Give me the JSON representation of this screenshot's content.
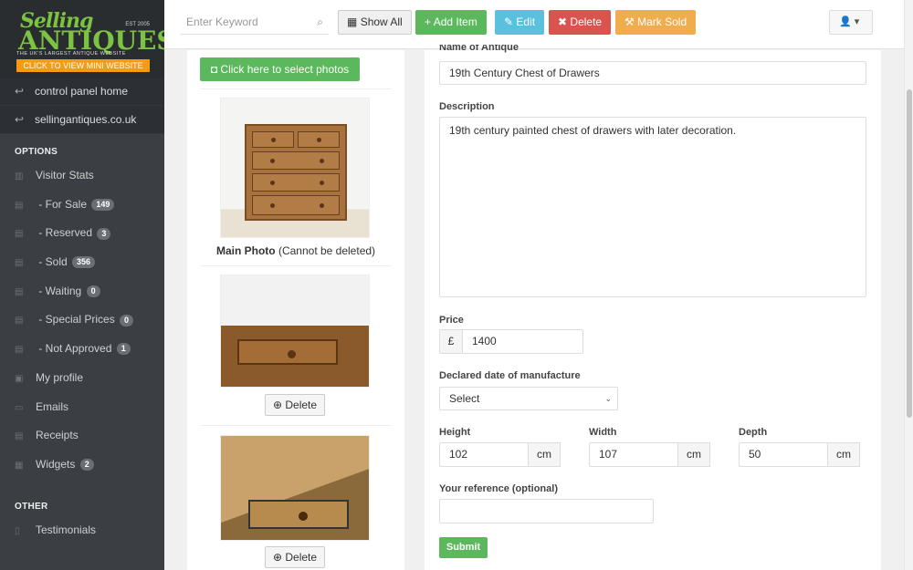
{
  "logo": {
    "selling": "Selling",
    "antiques": "ANTIQUES",
    "est": "EST 2005",
    "tagline": "THE UK'S LARGEST ANTIQUE WEBSITE",
    "mini_site": "CLICK TO VIEW MINI WEBSITE"
  },
  "sidebar": {
    "links": [
      {
        "label": "control panel home"
      },
      {
        "label": "sellingantiques.co.uk"
      }
    ],
    "options_heading": "OPTIONS",
    "items": [
      {
        "label": "Visitor Stats",
        "badge": ""
      },
      {
        "label": " - For Sale",
        "badge": "149"
      },
      {
        "label": " - Reserved",
        "badge": "3"
      },
      {
        "label": " - Sold",
        "badge": "356"
      },
      {
        "label": " - Waiting",
        "badge": "0"
      },
      {
        "label": " - Special Prices",
        "badge": "0"
      },
      {
        "label": " - Not Approved",
        "badge": "1"
      },
      {
        "label": "My profile",
        "badge": ""
      },
      {
        "label": "Emails",
        "badge": ""
      },
      {
        "label": "Receipts",
        "badge": ""
      },
      {
        "label": "Widgets",
        "badge": "2"
      }
    ],
    "other_heading": "OTHER",
    "other_items": [
      {
        "label": "Testimonials"
      }
    ]
  },
  "toolbar": {
    "search_placeholder": "Enter Keyword",
    "show_all": "Show All",
    "add_item": "Add Item",
    "edit": "Edit",
    "delete": "Delete",
    "mark_sold": "Mark Sold",
    "colors": {
      "add": "#5cb85c",
      "edit": "#5bc0de",
      "delete": "#d9534f",
      "sold": "#f0ad4e"
    }
  },
  "photos": {
    "select_button": "Click here to select photos",
    "main_label_bold": "Main Photo",
    "main_label_note": " (Cannot be deleted)",
    "delete_label": "Delete"
  },
  "form": {
    "name_label": "Name of Antique",
    "name_value": "19th Century Chest of Drawers",
    "description_label": "Description",
    "description_value": "19th century painted chest of drawers with later decoration.",
    "price_label": "Price",
    "currency": "£",
    "price_value": "1400",
    "date_label": "Declared date of manufacture",
    "date_value": "Select",
    "height_label": "Height",
    "height_value": "102",
    "width_label": "Width",
    "width_value": "107",
    "depth_label": "Depth",
    "depth_value": "50",
    "unit": "cm",
    "reference_label": "Your reference (optional)",
    "reference_value": "",
    "submit": "Submit"
  }
}
